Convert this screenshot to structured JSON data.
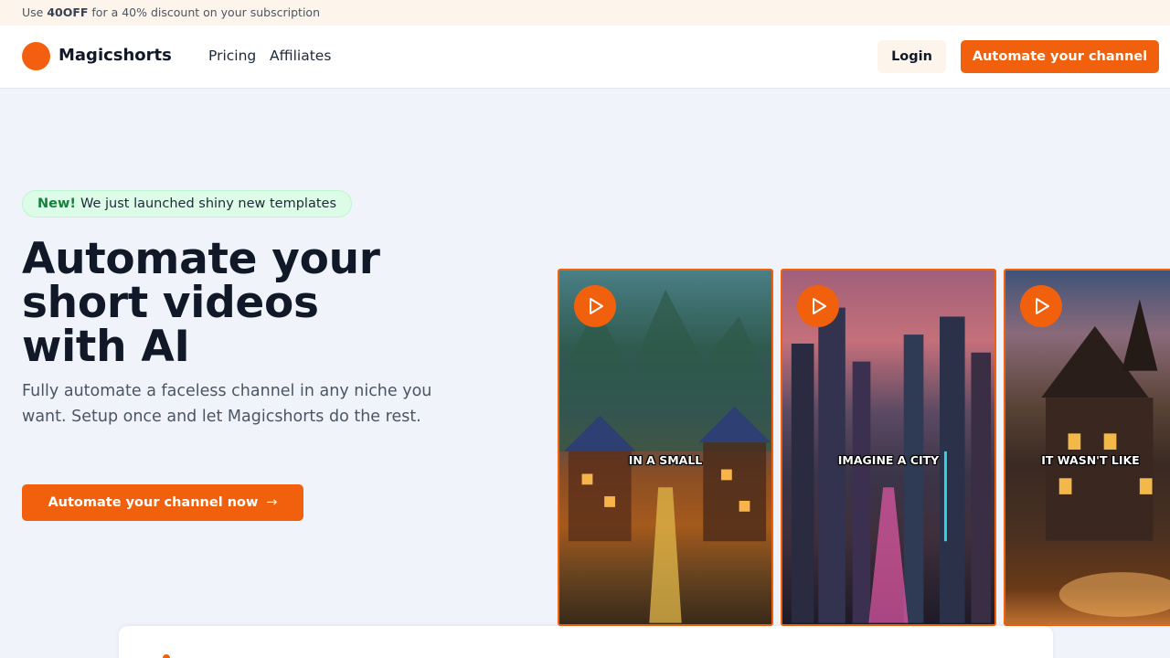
{
  "promo": {
    "prefix": "Use ",
    "code": "40OFF",
    "suffix": " for a 40% discount on your subscription"
  },
  "nav": {
    "brand": "Magicshorts",
    "links": [
      "Pricing",
      "Affiliates"
    ],
    "login_label": "Login",
    "cta_label": "Automate your channel"
  },
  "hero": {
    "badge_new": "New!",
    "badge_text": "We just launched shiny new templates",
    "title_line1": "Automate your",
    "title_line2": "short videos",
    "title_line3": "with AI",
    "subtitle": "Fully automate a faceless channel in any niche you want. Setup once and let Magicshorts do the rest.",
    "cta_label": "Automate your channel now",
    "cta_arrow": "→"
  },
  "videos": [
    {
      "caption": "IN A SMALL",
      "icon": "play-icon"
    },
    {
      "caption": "IMAGINE A CITY",
      "icon": "play-icon"
    },
    {
      "caption": "IT WASN'T LIKE",
      "icon": "play-icon"
    }
  ],
  "colors": {
    "accent": "#f0600d",
    "background": "#f0f4fa",
    "promo_bg": "#fdf5ec",
    "badge_bg": "#dcfce7",
    "badge_new": "#15803d"
  }
}
